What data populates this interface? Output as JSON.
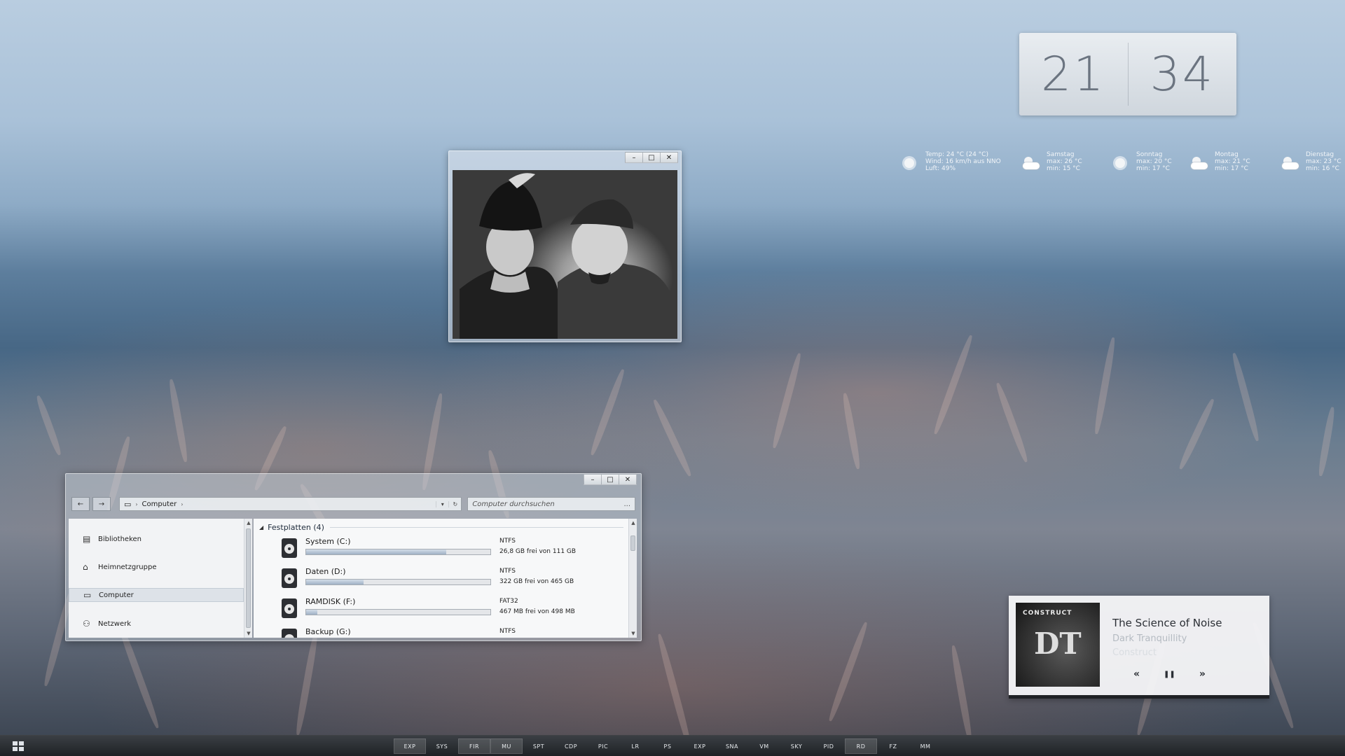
{
  "clock": {
    "hours": "21",
    "minutes": "34"
  },
  "weather": [
    {
      "icon": "sun-icon",
      "lines": [
        "Temp: 24 °C (24 °C)",
        "Wind: 16 km/h aus NNO",
        "Luft: 49%"
      ]
    },
    {
      "icon": "partly-cloudy-icon",
      "lines": [
        "Samstag",
        "max: 26 °C",
        "min: 15 °C"
      ]
    },
    {
      "icon": "sun-icon",
      "lines": [
        "Sonntag",
        "max: 20 °C",
        "min: 17 °C"
      ]
    },
    {
      "icon": "partly-cloudy-icon",
      "lines": [
        "Montag",
        "max: 21 °C",
        "min: 17 °C"
      ]
    },
    {
      "icon": "partly-cloudy-icon",
      "lines": [
        "Dienstag",
        "max: 23 °C",
        "min: 16 °C"
      ]
    }
  ],
  "window_buttons": {
    "minimize": "–",
    "maximize": "□",
    "close": "✕"
  },
  "explorer": {
    "back": "←",
    "forward": "→",
    "breadcrumb": "Computer",
    "search_placeholder": "Computer durchsuchen",
    "search_more": "...",
    "nav_items": [
      {
        "label": "Bibliotheken",
        "icon": "libraries-icon",
        "selected": false
      },
      {
        "label": "Heimnetzgruppe",
        "icon": "homegroup-icon",
        "selected": false
      },
      {
        "label": "Computer",
        "icon": "computer-icon",
        "selected": true
      },
      {
        "label": "Netzwerk",
        "icon": "network-icon",
        "selected": false
      }
    ],
    "group_header": "Festplatten (4)",
    "drives": [
      {
        "name": "System (C:)",
        "fs": "NTFS",
        "free": "26,8 GB frei von 111 GB",
        "used_fraction": 0.76
      },
      {
        "name": "Daten (D:)",
        "fs": "NTFS",
        "free": "322 GB frei von 465 GB",
        "used_fraction": 0.31
      },
      {
        "name": "RAMDISK (F:)",
        "fs": "FAT32",
        "free": "467 MB frei von 498 MB",
        "used_fraction": 0.06
      },
      {
        "name": "Backup (G:)",
        "fs": "NTFS",
        "free": "",
        "used_fraction": 0
      }
    ]
  },
  "music": {
    "song": "The Science of Noise",
    "artist": "Dark Tranquillity",
    "album": "Construct",
    "cover_text_top": "CONSTRUCT",
    "cover_text_logo": "DT",
    "prev": "«",
    "pause": "❚❚",
    "next": "»"
  },
  "taskbar": {
    "items": [
      {
        "label": "EXP",
        "active": true
      },
      {
        "label": "SYS",
        "active": false
      },
      {
        "label": "FIR",
        "active": true
      },
      {
        "label": "MU",
        "active": true
      },
      {
        "label": "SPT",
        "active": false
      },
      {
        "label": "CDP",
        "active": false
      },
      {
        "label": "PIC",
        "active": false
      },
      {
        "label": "LR",
        "active": false
      },
      {
        "label": "PS",
        "active": false
      },
      {
        "label": "EXP",
        "active": false
      },
      {
        "label": "SNA",
        "active": false
      },
      {
        "label": "VM",
        "active": false
      },
      {
        "label": "SKY",
        "active": false
      },
      {
        "label": "PID",
        "active": false
      },
      {
        "label": "RD",
        "active": true
      },
      {
        "label": "FZ",
        "active": false
      },
      {
        "label": "MM",
        "active": false
      }
    ]
  }
}
